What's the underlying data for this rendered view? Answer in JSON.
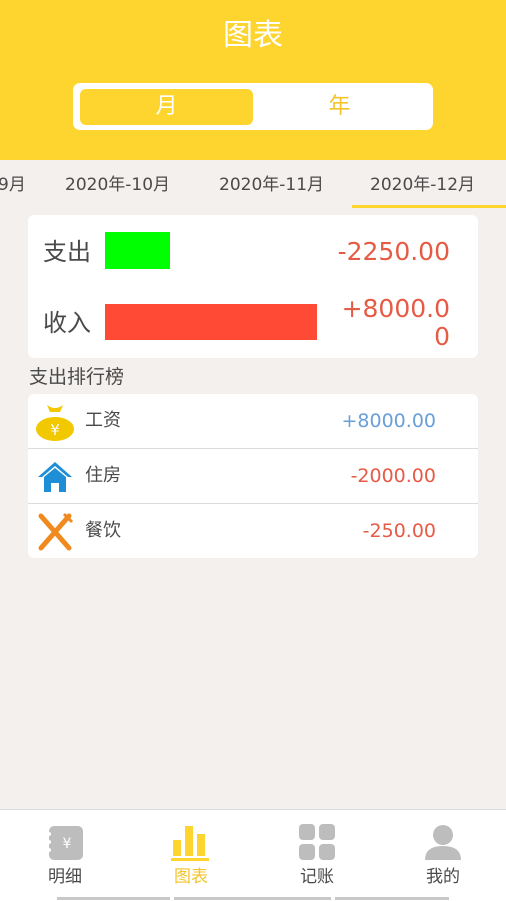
{
  "header": {
    "title": "图表",
    "segments": [
      {
        "label": "月",
        "active": true
      },
      {
        "label": "年",
        "active": false
      }
    ]
  },
  "months": [
    {
      "label": "9月",
      "active": false
    },
    {
      "label": "2020年-10月",
      "active": false
    },
    {
      "label": "2020年-11月",
      "active": false
    },
    {
      "label": "2020年-12月",
      "active": true
    }
  ],
  "summary": {
    "expense": {
      "label": "支出",
      "value": "-2250.00",
      "bar_color": "#00ff00"
    },
    "income": {
      "label": "收入",
      "value": "+8000.00",
      "bar_color": "#ff4b36"
    }
  },
  "ranking": {
    "title": "支出排行榜",
    "items": [
      {
        "label": "工资",
        "value": "+8000.00",
        "icon": "money-bag-icon",
        "value_color": "#6a9fd8"
      },
      {
        "label": "住房",
        "value": "-2000.00",
        "icon": "house-icon",
        "value_color": "#e65b46"
      },
      {
        "label": "餐饮",
        "value": "-250.00",
        "icon": "fork-knife-icon",
        "value_color": "#e65b46"
      }
    ]
  },
  "tabbar": [
    {
      "label": "明细",
      "icon": "ledger-icon",
      "active": false
    },
    {
      "label": "图表",
      "icon": "bar-chart-icon",
      "active": true
    },
    {
      "label": "记账",
      "icon": "grid-icon",
      "active": false
    },
    {
      "label": "我的",
      "icon": "user-icon",
      "active": false
    }
  ],
  "colors": {
    "brand_yellow": "#fed42f",
    "expense_red": "#e65b46",
    "income_blue": "#6a9fd8"
  }
}
